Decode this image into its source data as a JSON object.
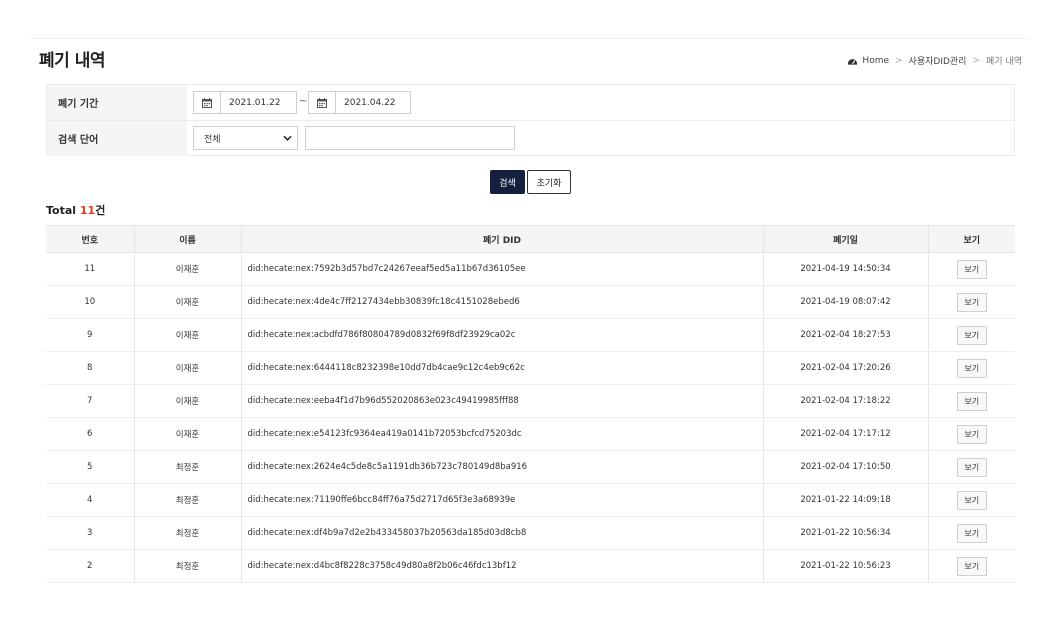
{
  "page": {
    "title": "폐기 내역"
  },
  "breadcrumb": {
    "home": "Home",
    "section": "사용자DID관리",
    "current": "폐기 내역"
  },
  "search": {
    "period_label": "폐기 기간",
    "date_from": "2021.01.22",
    "tilde": "~",
    "date_to": "2021.04.22",
    "keyword_label": "검색 단어",
    "scope_selected": "전체",
    "keyword_value": "",
    "search_button": "검색",
    "reset_button": "초기화"
  },
  "summary": {
    "prefix": "Total ",
    "count": "11",
    "suffix": "건"
  },
  "table": {
    "columns": [
      "번호",
      "이름",
      "폐기 DID",
      "폐기일",
      "보기"
    ],
    "view_label": "보기",
    "rows": [
      {
        "no": "11",
        "name": "이재훈",
        "did": "did:hecate:nex:7592b3d57bd7c24267eeaf5ed5a11b67d36105ee",
        "date": "2021-04-19 14:50:34"
      },
      {
        "no": "10",
        "name": "이재훈",
        "did": "did:hecate:nex:4de4c7ff2127434ebb30839fc18c4151028ebed6",
        "date": "2021-04-19 08:07:42"
      },
      {
        "no": "9",
        "name": "이재훈",
        "did": "did:hecate:nex:acbdfd786f80804789d0832f69f8df23929ca02c",
        "date": "2021-02-04 18:27:53"
      },
      {
        "no": "8",
        "name": "이재훈",
        "did": "did:hecate:nex:6444118c8232398e10dd7db4cae9c12c4eb9c62c",
        "date": "2021-02-04 17:20:26"
      },
      {
        "no": "7",
        "name": "이재훈",
        "did": "did:hecate:nex:eeba4f1d7b96d552020863e023c49419985fff88",
        "date": "2021-02-04 17:18:22"
      },
      {
        "no": "6",
        "name": "이재훈",
        "did": "did:hecate:nex:e54123fc9364ea419a0141b72053bcfcd75203dc",
        "date": "2021-02-04 17:17:12"
      },
      {
        "no": "5",
        "name": "최정훈",
        "did": "did:hecate:nex:2624e4c5de8c5a1191db36b723c780149d8ba916",
        "date": "2021-02-04 17:10:50"
      },
      {
        "no": "4",
        "name": "최정훈",
        "did": "did:hecate:nex:71190ffe6bcc84ff76a75d2717d65f3e3a68939e",
        "date": "2021-01-22 14:09:18"
      },
      {
        "no": "3",
        "name": "최정훈",
        "did": "did:hecate:nex:df4b9a7d2e2b433458037b20563da185d03d8cb8",
        "date": "2021-01-22 10:56:34"
      },
      {
        "no": "2",
        "name": "최정훈",
        "did": "did:hecate:nex:d4bc8f8228c3758c49d80a8f2b06c46fdc13bf12",
        "date": "2021-01-22 10:56:23"
      }
    ]
  },
  "colors": {
    "primary_button": "#13213f",
    "count_accent": "#e53a1f",
    "header_bg": "#f5f5f5"
  },
  "icons": {
    "home": "dashboard-icon",
    "date": "calendar-icon",
    "select": "chevron-down-icon"
  }
}
